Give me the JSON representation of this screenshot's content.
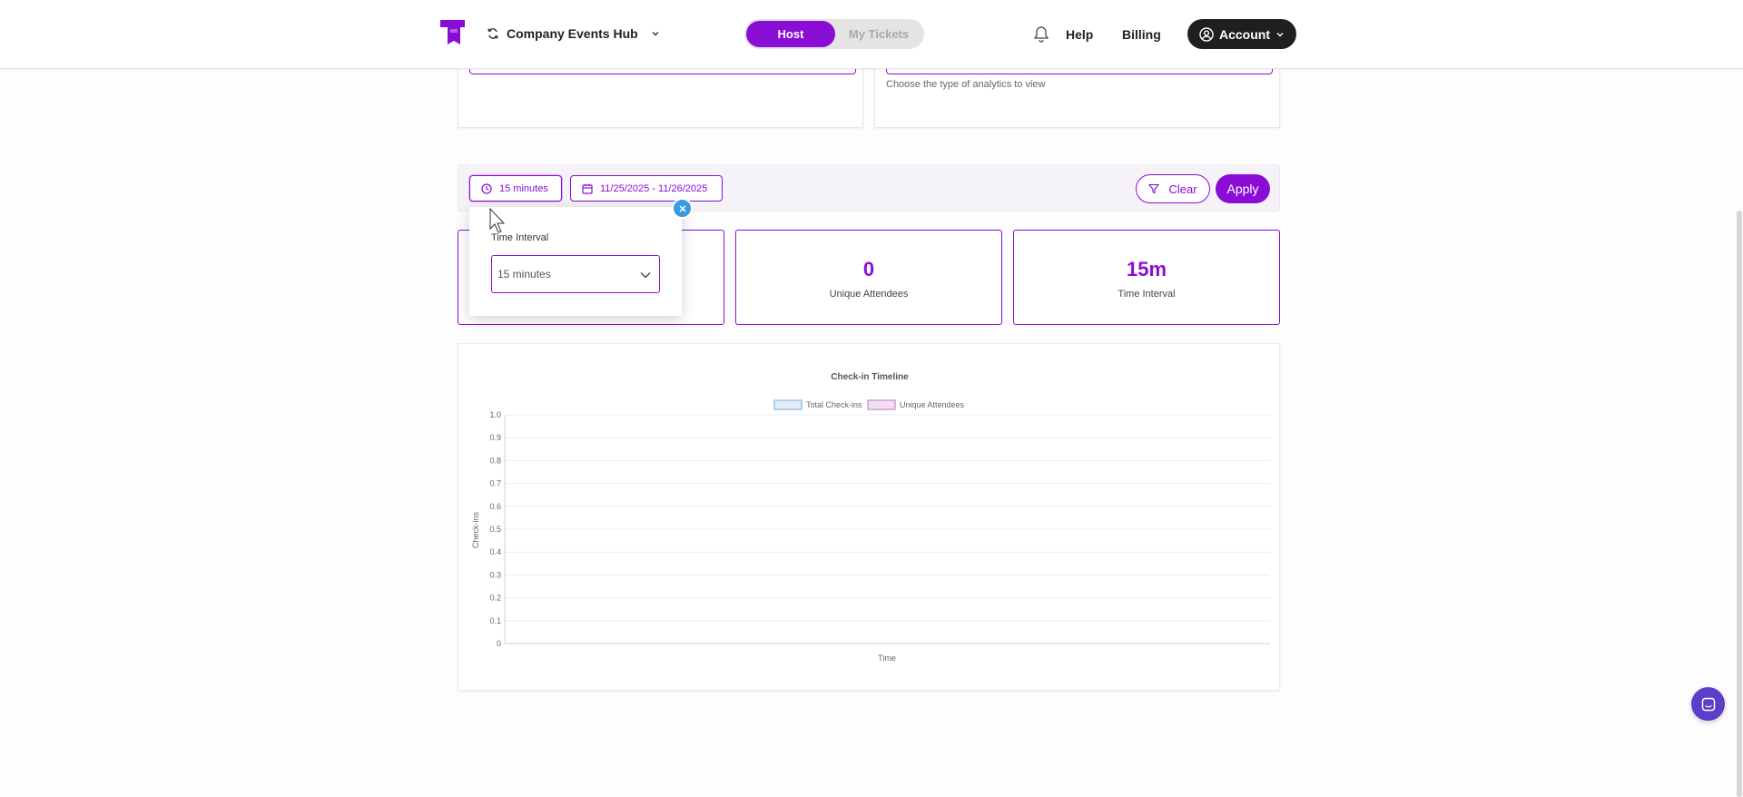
{
  "header": {
    "workspace_name": "Company Events Hub",
    "toggle_host": "Host",
    "toggle_tickets": "My Tickets",
    "help": "Help",
    "billing": "Billing",
    "account": "Account"
  },
  "top_cards": {
    "right_help": "Choose the type of analytics to view"
  },
  "filters": {
    "interval_chip": "15 minutes",
    "date_range_chip": "11/25/2025 - 11/26/2025",
    "clear": "Clear",
    "apply": "Apply"
  },
  "popover": {
    "title": "Time Interval",
    "selected": "15 minutes"
  },
  "stats": [
    {
      "value": "",
      "label": ""
    },
    {
      "value": "0",
      "label": "Unique Attendees"
    },
    {
      "value": "15m",
      "label": "Time Interval"
    }
  ],
  "colors": {
    "accent": "#8a0dd6",
    "dark": "#1f1f1f",
    "close_badge": "#3b9be0",
    "chat": "#5b3fc8"
  },
  "chart_data": {
    "type": "line",
    "title": "Check-in Timeline",
    "xlabel": "Time",
    "ylabel": "Check-ins",
    "ylim": [
      0,
      1.0
    ],
    "y_ticks": [
      "1.0",
      "0.9",
      "0.8",
      "0.7",
      "0.6",
      "0.5",
      "0.4",
      "0.3",
      "0.2",
      "0.1",
      "0"
    ],
    "legend_position": "top",
    "series": [
      {
        "name": "Total Check-ins",
        "values": [],
        "color": "#9cc4e8"
      },
      {
        "name": "Unique Attendees",
        "values": [],
        "color": "#d49ad6"
      }
    ],
    "grid": true
  }
}
